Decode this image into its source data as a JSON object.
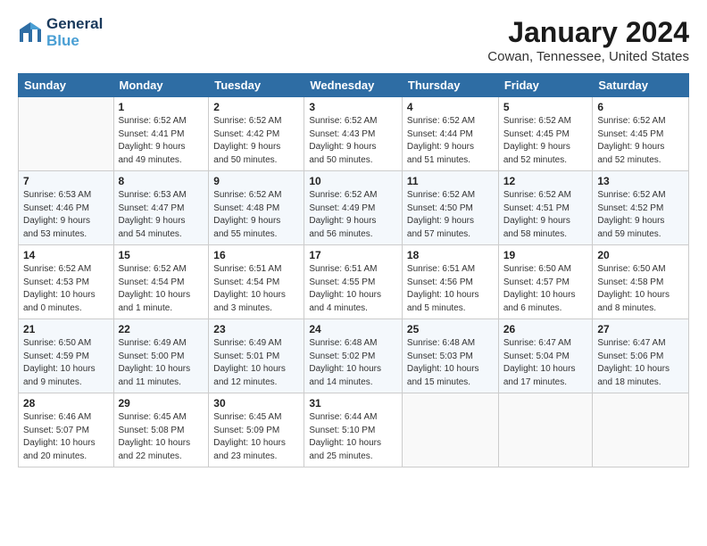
{
  "header": {
    "logo_line1": "General",
    "logo_line2": "Blue",
    "month": "January 2024",
    "location": "Cowan, Tennessee, United States"
  },
  "weekdays": [
    "Sunday",
    "Monday",
    "Tuesday",
    "Wednesday",
    "Thursday",
    "Friday",
    "Saturday"
  ],
  "weeks": [
    [
      {
        "day": "",
        "info": ""
      },
      {
        "day": "1",
        "info": "Sunrise: 6:52 AM\nSunset: 4:41 PM\nDaylight: 9 hours\nand 49 minutes."
      },
      {
        "day": "2",
        "info": "Sunrise: 6:52 AM\nSunset: 4:42 PM\nDaylight: 9 hours\nand 50 minutes."
      },
      {
        "day": "3",
        "info": "Sunrise: 6:52 AM\nSunset: 4:43 PM\nDaylight: 9 hours\nand 50 minutes."
      },
      {
        "day": "4",
        "info": "Sunrise: 6:52 AM\nSunset: 4:44 PM\nDaylight: 9 hours\nand 51 minutes."
      },
      {
        "day": "5",
        "info": "Sunrise: 6:52 AM\nSunset: 4:45 PM\nDaylight: 9 hours\nand 52 minutes."
      },
      {
        "day": "6",
        "info": "Sunrise: 6:52 AM\nSunset: 4:45 PM\nDaylight: 9 hours\nand 52 minutes."
      }
    ],
    [
      {
        "day": "7",
        "info": "Sunrise: 6:53 AM\nSunset: 4:46 PM\nDaylight: 9 hours\nand 53 minutes."
      },
      {
        "day": "8",
        "info": "Sunrise: 6:53 AM\nSunset: 4:47 PM\nDaylight: 9 hours\nand 54 minutes."
      },
      {
        "day": "9",
        "info": "Sunrise: 6:52 AM\nSunset: 4:48 PM\nDaylight: 9 hours\nand 55 minutes."
      },
      {
        "day": "10",
        "info": "Sunrise: 6:52 AM\nSunset: 4:49 PM\nDaylight: 9 hours\nand 56 minutes."
      },
      {
        "day": "11",
        "info": "Sunrise: 6:52 AM\nSunset: 4:50 PM\nDaylight: 9 hours\nand 57 minutes."
      },
      {
        "day": "12",
        "info": "Sunrise: 6:52 AM\nSunset: 4:51 PM\nDaylight: 9 hours\nand 58 minutes."
      },
      {
        "day": "13",
        "info": "Sunrise: 6:52 AM\nSunset: 4:52 PM\nDaylight: 9 hours\nand 59 minutes."
      }
    ],
    [
      {
        "day": "14",
        "info": "Sunrise: 6:52 AM\nSunset: 4:53 PM\nDaylight: 10 hours\nand 0 minutes."
      },
      {
        "day": "15",
        "info": "Sunrise: 6:52 AM\nSunset: 4:54 PM\nDaylight: 10 hours\nand 1 minute."
      },
      {
        "day": "16",
        "info": "Sunrise: 6:51 AM\nSunset: 4:54 PM\nDaylight: 10 hours\nand 3 minutes."
      },
      {
        "day": "17",
        "info": "Sunrise: 6:51 AM\nSunset: 4:55 PM\nDaylight: 10 hours\nand 4 minutes."
      },
      {
        "day": "18",
        "info": "Sunrise: 6:51 AM\nSunset: 4:56 PM\nDaylight: 10 hours\nand 5 minutes."
      },
      {
        "day": "19",
        "info": "Sunrise: 6:50 AM\nSunset: 4:57 PM\nDaylight: 10 hours\nand 6 minutes."
      },
      {
        "day": "20",
        "info": "Sunrise: 6:50 AM\nSunset: 4:58 PM\nDaylight: 10 hours\nand 8 minutes."
      }
    ],
    [
      {
        "day": "21",
        "info": "Sunrise: 6:50 AM\nSunset: 4:59 PM\nDaylight: 10 hours\nand 9 minutes."
      },
      {
        "day": "22",
        "info": "Sunrise: 6:49 AM\nSunset: 5:00 PM\nDaylight: 10 hours\nand 11 minutes."
      },
      {
        "day": "23",
        "info": "Sunrise: 6:49 AM\nSunset: 5:01 PM\nDaylight: 10 hours\nand 12 minutes."
      },
      {
        "day": "24",
        "info": "Sunrise: 6:48 AM\nSunset: 5:02 PM\nDaylight: 10 hours\nand 14 minutes."
      },
      {
        "day": "25",
        "info": "Sunrise: 6:48 AM\nSunset: 5:03 PM\nDaylight: 10 hours\nand 15 minutes."
      },
      {
        "day": "26",
        "info": "Sunrise: 6:47 AM\nSunset: 5:04 PM\nDaylight: 10 hours\nand 17 minutes."
      },
      {
        "day": "27",
        "info": "Sunrise: 6:47 AM\nSunset: 5:06 PM\nDaylight: 10 hours\nand 18 minutes."
      }
    ],
    [
      {
        "day": "28",
        "info": "Sunrise: 6:46 AM\nSunset: 5:07 PM\nDaylight: 10 hours\nand 20 minutes."
      },
      {
        "day": "29",
        "info": "Sunrise: 6:45 AM\nSunset: 5:08 PM\nDaylight: 10 hours\nand 22 minutes."
      },
      {
        "day": "30",
        "info": "Sunrise: 6:45 AM\nSunset: 5:09 PM\nDaylight: 10 hours\nand 23 minutes."
      },
      {
        "day": "31",
        "info": "Sunrise: 6:44 AM\nSunset: 5:10 PM\nDaylight: 10 hours\nand 25 minutes."
      },
      {
        "day": "",
        "info": ""
      },
      {
        "day": "",
        "info": ""
      },
      {
        "day": "",
        "info": ""
      }
    ]
  ]
}
